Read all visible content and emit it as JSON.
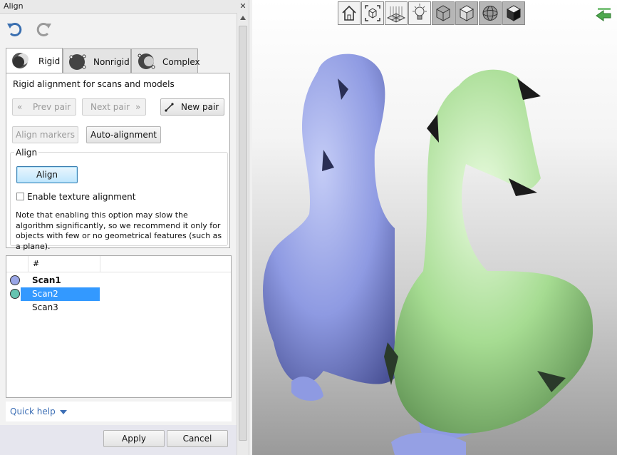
{
  "window": {
    "title": "Align"
  },
  "tabs": [
    {
      "label": "Rigid"
    },
    {
      "label": "Nonrigid"
    },
    {
      "label": "Complex"
    }
  ],
  "rigid": {
    "description": "Rigid alignment for scans and models",
    "prev_pair": "Prev pair",
    "next_pair": "Next pair",
    "new_pair": "New pair",
    "align_markers": "Align markers",
    "auto_alignment": "Auto-alignment",
    "group_label": "Align",
    "align_button": "Align",
    "texture_checkbox": "Enable texture alignment",
    "texture_checked": false,
    "note": "Note that enabling this option may slow the algorithm significantly, so we recommend it only for objects with few or no geometrical features (such as a plane)."
  },
  "scan_list": {
    "column_header": "#",
    "rows": [
      {
        "name": "Scan1",
        "color": "#9aa6e6",
        "bold": true,
        "selected": false
      },
      {
        "name": "Scan2",
        "color": "#66c4b0",
        "bold": false,
        "selected": true
      },
      {
        "name": "Scan3",
        "color": "",
        "bold": false,
        "selected": false
      }
    ]
  },
  "quick_help": "Quick help",
  "footer": {
    "apply": "Apply",
    "cancel": "Cancel"
  },
  "viewport": {
    "toolbar": [
      "home-icon",
      "fit-view-icon",
      "grid-icon",
      "light-icon",
      "wireframe-cube-icon",
      "flat-cube-icon",
      "sphere-icon",
      "solid-cube-icon"
    ],
    "models": [
      {
        "name": "blue-duck-model",
        "color": "#8e9ae2"
      },
      {
        "name": "green-duck-model",
        "color": "#a6dc92"
      }
    ]
  }
}
